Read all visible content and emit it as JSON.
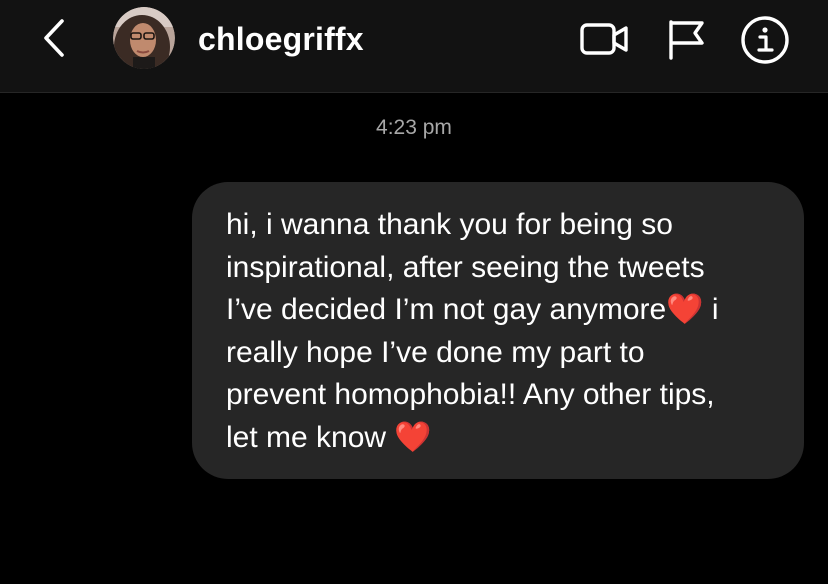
{
  "header": {
    "username": "chloegriffx",
    "icons": {
      "back": "chevron-left-icon",
      "video": "video-camera-icon",
      "flag": "flag-icon",
      "info": "info-icon"
    }
  },
  "conversation": {
    "timestamp": "4:23 pm",
    "messages": [
      {
        "lines": [
          "hi, i wanna thank you for being so",
          "inspirational, after seeing the tweets",
          "I’ve decided I’m not gay anymore",
          " i",
          "really hope I’ve done my part to",
          "prevent homophobia!! Any other tips,",
          "let me know "
        ],
        "emoji": "❤️"
      }
    ]
  },
  "colors": {
    "background": "#000000",
    "header": "#121212",
    "bubble": "#262626",
    "text": "#ffffff",
    "timestamp": "#a8a8a8",
    "heart": "#ff4f3a"
  }
}
